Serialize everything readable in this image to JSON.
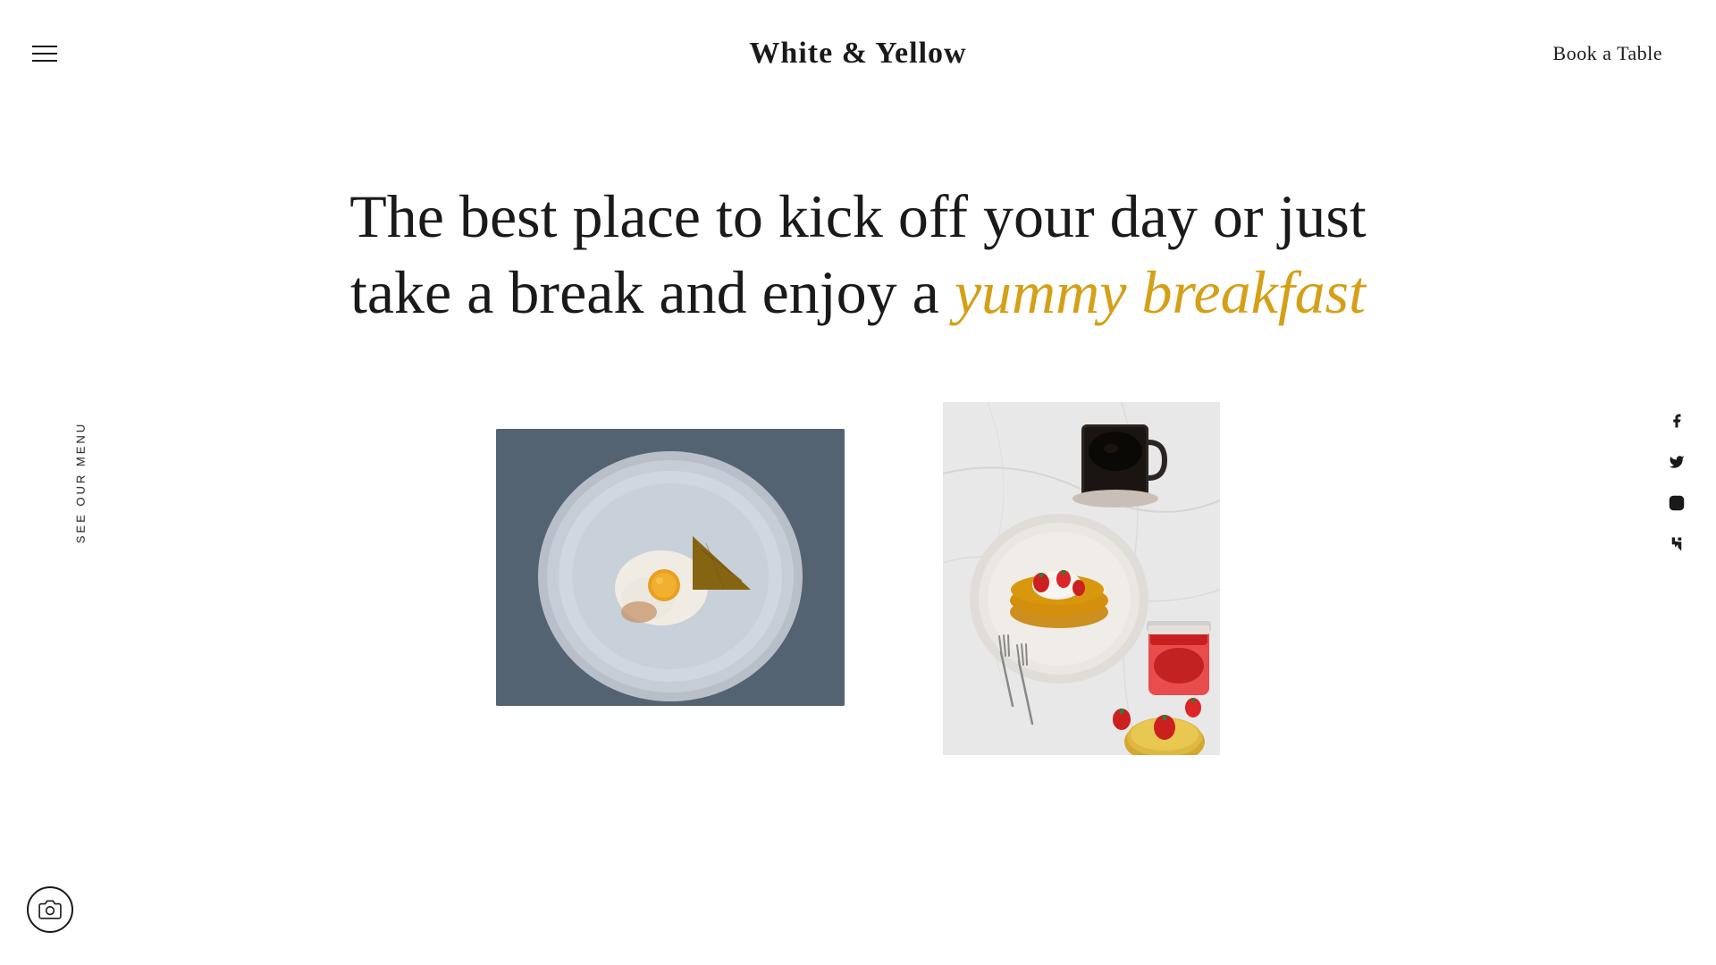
{
  "header": {
    "site_title": "White & Yellow",
    "book_table_label": "Book a Table"
  },
  "hero": {
    "line1": "The best place to kick off your day or just",
    "line2_normal": "take a break and enjoy a ",
    "line2_highlight": "yummy breakfast"
  },
  "sidebar": {
    "menu_text": "See Our Menu"
  },
  "social": {
    "facebook_label": "Facebook",
    "twitter_label": "Twitter",
    "instagram_label": "Instagram",
    "foursquare_label": "Foursquare"
  },
  "camera": {
    "label": "Camera"
  },
  "images": {
    "image1_alt": "Breakfast plate with fried egg and toast on blue plate",
    "image2_alt": "Pancakes with strawberries and cream, coffee, jam on marble surface"
  },
  "colors": {
    "accent": "#d4a017",
    "text_dark": "#1a1a1a",
    "bg": "#ffffff"
  }
}
